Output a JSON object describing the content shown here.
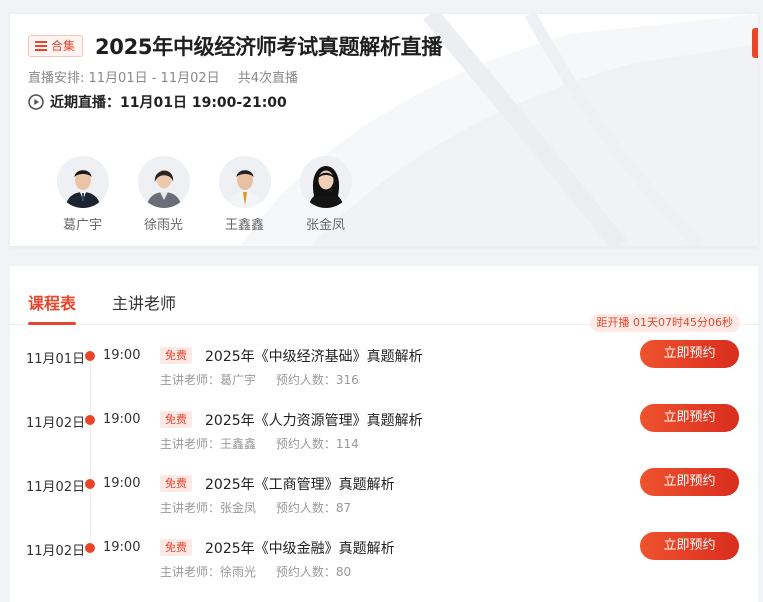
{
  "header": {
    "badge_label": "合集",
    "title": "2025年中级经济师考试真题解析直播",
    "schedule": "直播安排: 11月01日 - 11月02日",
    "schedule_count": "共4次直播",
    "next_live": "近期直播：11月01日 19:00-21:00",
    "teachers": [
      {
        "name": "葛广宇"
      },
      {
        "name": "徐雨光"
      },
      {
        "name": "王鑫鑫"
      },
      {
        "name": "张金凤"
      }
    ]
  },
  "tabs": [
    {
      "label": "课程表",
      "active": true
    },
    {
      "label": "主讲老师",
      "active": false
    }
  ],
  "countdown": "距开播 01天07时45分06秒",
  "sessions": [
    {
      "date": "11月01日",
      "time": "19:00",
      "free": "免费",
      "course": "2025年《中级经济基础》真题解析",
      "teacher": "主讲老师：葛广宇",
      "reservations": "预约人数：316",
      "button": "立即预约"
    },
    {
      "date": "11月02日",
      "time": "19:00",
      "free": "免费",
      "course": "2025年《人力资源管理》真题解析",
      "teacher": "主讲老师：王鑫鑫",
      "reservations": "预约人数：114",
      "button": "立即预约"
    },
    {
      "date": "11月02日",
      "time": "19:00",
      "free": "免费",
      "course": "2025年《工商管理》真题解析",
      "teacher": "主讲老师：张金凤",
      "reservations": "预约人数：87",
      "button": "立即预约"
    },
    {
      "date": "11月02日",
      "time": "19:00",
      "free": "免费",
      "course": "2025年《中级金融》真题解析",
      "teacher": "主讲老师：徐雨光",
      "reservations": "预约人数：80",
      "button": "立即预约"
    }
  ],
  "colors": {
    "accent": "#e8462b"
  },
  "icons": {
    "badge": "list-icon",
    "next_live": "play-circle-icon"
  }
}
